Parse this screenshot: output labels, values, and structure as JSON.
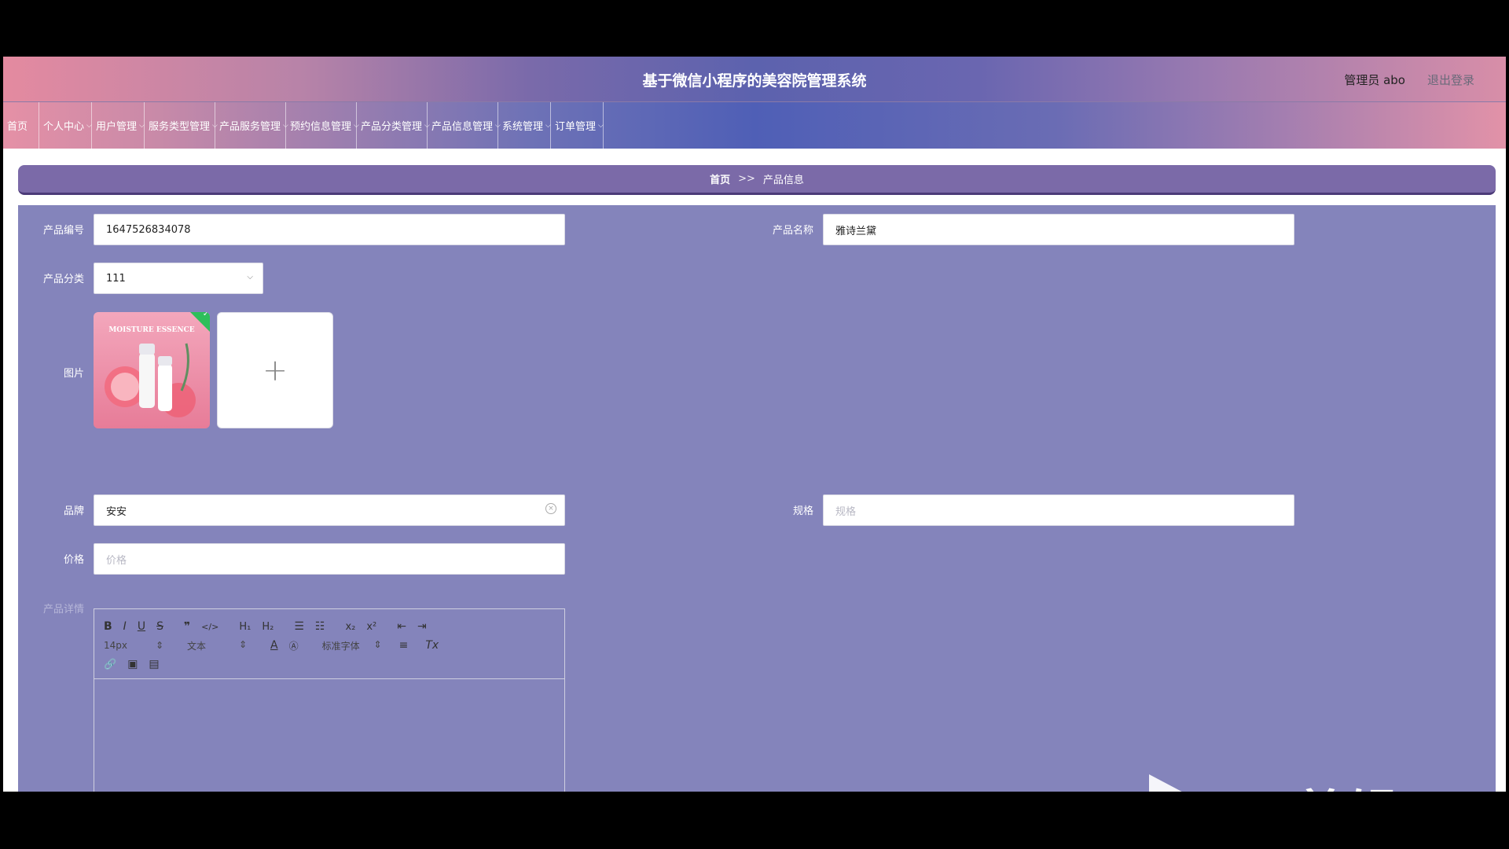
{
  "header": {
    "title": "基于微信小程序的美容院管理系统",
    "user_label": "管理员 abo",
    "logout_label": "退出登录"
  },
  "nav": {
    "items": [
      {
        "label": "首页",
        "has_dropdown": false
      },
      {
        "label": "个人中心",
        "has_dropdown": true
      },
      {
        "label": "用户管理",
        "has_dropdown": true
      },
      {
        "label": "服务类型管理",
        "has_dropdown": true
      },
      {
        "label": "产品服务管理",
        "has_dropdown": true
      },
      {
        "label": "预约信息管理",
        "has_dropdown": true
      },
      {
        "label": "产品分类管理",
        "has_dropdown": true
      },
      {
        "label": "产品信息管理",
        "has_dropdown": true
      },
      {
        "label": "系统管理",
        "has_dropdown": true
      },
      {
        "label": "订单管理",
        "has_dropdown": true
      }
    ]
  },
  "breadcrumb": {
    "home": "首页",
    "separator": ">>",
    "current": "产品信息"
  },
  "form": {
    "product_code": {
      "label": "产品编号",
      "value": "1647526834078"
    },
    "product_name": {
      "label": "产品名称",
      "value": "雅诗兰黛"
    },
    "product_category": {
      "label": "产品分类",
      "value": "111"
    },
    "image": {
      "label": "图片",
      "thumb_caption": "MOISTURE ESSENCE"
    },
    "brand": {
      "label": "品牌",
      "value": "安安"
    },
    "spec": {
      "label": "规格",
      "placeholder": "规格"
    },
    "price": {
      "label": "价格",
      "placeholder": "价格"
    },
    "details": {
      "label": "产品详情"
    }
  },
  "editor": {
    "font_size": "14px",
    "text_style": "文本",
    "font_family": "标准字体"
  },
  "watermark": {
    "text": "ev剪辑"
  }
}
